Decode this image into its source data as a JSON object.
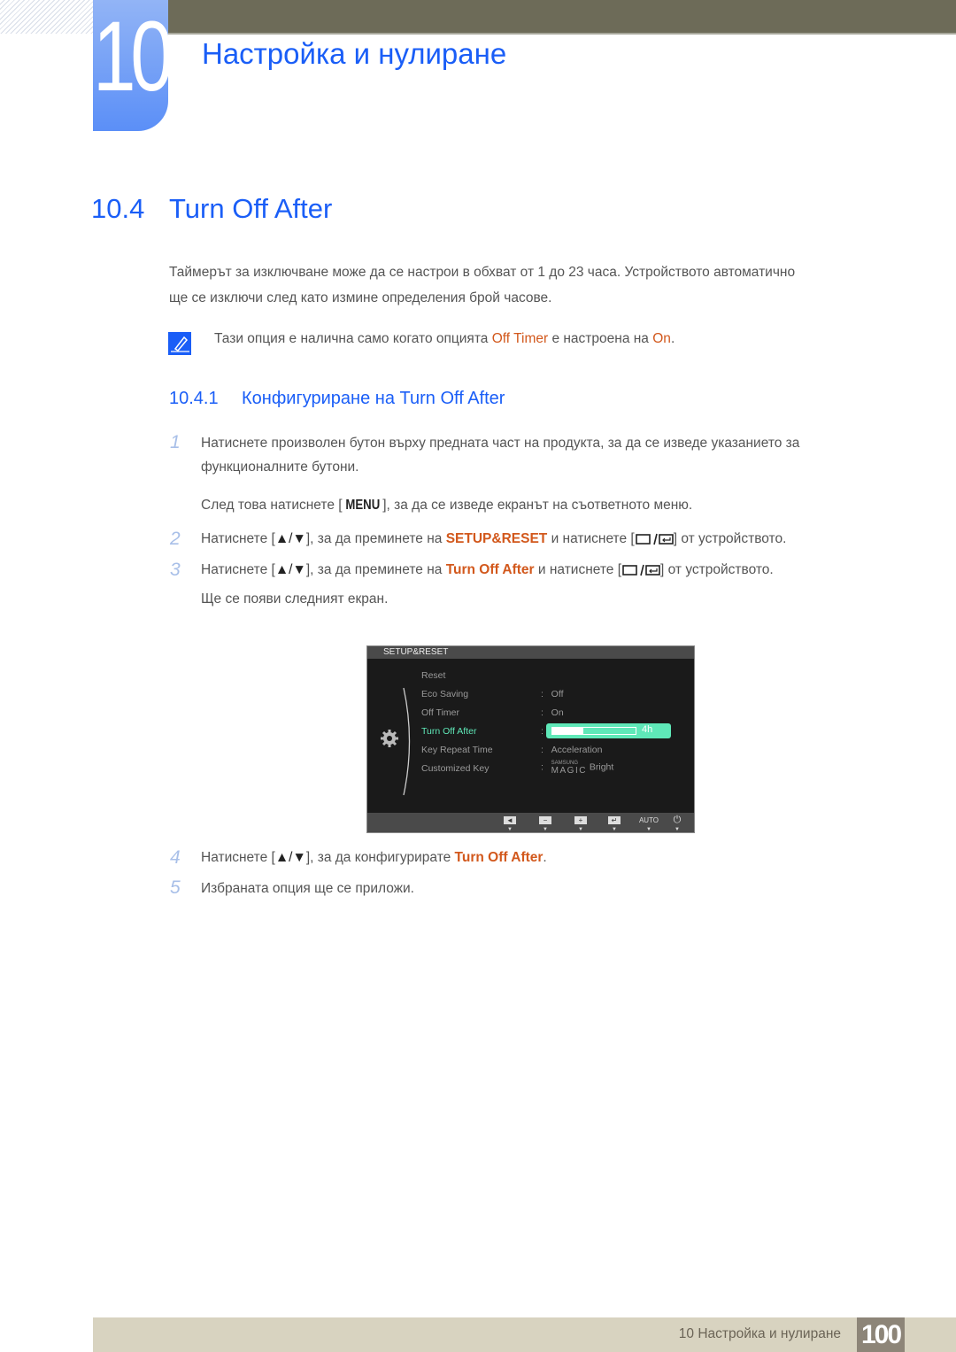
{
  "chapter": {
    "number": "10",
    "title": "Настройка и нулиране"
  },
  "section": {
    "number": "10.4",
    "title": "Turn Off After"
  },
  "intro": {
    "line1": "Таймерът за изключване може да се настрои в обхват от 1 до 23 часа. Устройството автоматично",
    "line2": "ще се изключи след като измине определения брой часове."
  },
  "note": {
    "icon": "note-pencil-icon",
    "prefix": "Тази опция е налична само когато опцията ",
    "term1": "Off Timer",
    "middle": " е настроена на ",
    "term2": "On",
    "suffix": "."
  },
  "subsection": {
    "number": "10.4.1",
    "title": "Конфигуриране на Turn Off After"
  },
  "steps": [
    {
      "n": "1",
      "line1": "Натиснете произволен бутон върху предната част на продукта, за да се изведе указанието за",
      "line2": "функционалните бутони.",
      "line3a": "След това натиснете [",
      "key": "MENU",
      "line3b": "], за да се изведе екранът на съответното меню."
    },
    {
      "n": "2",
      "a": "Натиснете [",
      "b": "], за да преминете на ",
      "term": "SETUP&RESET",
      "c": " и натиснете [",
      "d": "] от устройството."
    },
    {
      "n": "3",
      "a": "Натиснете [",
      "b": "], за да преминете на ",
      "term": "Turn Off After",
      "c": " и натиснете [",
      "d": "] от устройството.",
      "line2": "Ще се появи следният екран."
    },
    {
      "n": "4",
      "a": "Натиснете [",
      "b": "], за да конфигурирате ",
      "term": "Turn Off After",
      "c": "."
    },
    {
      "n": "5",
      "a": "Избраната опция ще се приложи."
    }
  ],
  "osd": {
    "header": "SETUP&RESET",
    "items": [
      {
        "label": "Reset",
        "value": ""
      },
      {
        "label": "Eco Saving",
        "value": "Off"
      },
      {
        "label": "Off Timer",
        "value": "On"
      },
      {
        "label": "Turn Off After",
        "value": "4h",
        "selected": true,
        "progress": 0.37
      },
      {
        "label": "Key Repeat Time",
        "value": "Acceleration"
      },
      {
        "label": "Customized Key",
        "value_small": "SAMSUNG",
        "value_brand": "MAGIC",
        "value": "Bright"
      }
    ],
    "footer_buttons": [
      "◄",
      "−",
      "+",
      "↵",
      "AUTO",
      "⏻"
    ]
  },
  "footer": {
    "text": "10 Настройка и нулиране",
    "page": "100"
  },
  "colors": {
    "accent_blue": "#1a5ef7",
    "term_orange": "#d2581c",
    "osd_highlight": "#5fe8b8"
  }
}
